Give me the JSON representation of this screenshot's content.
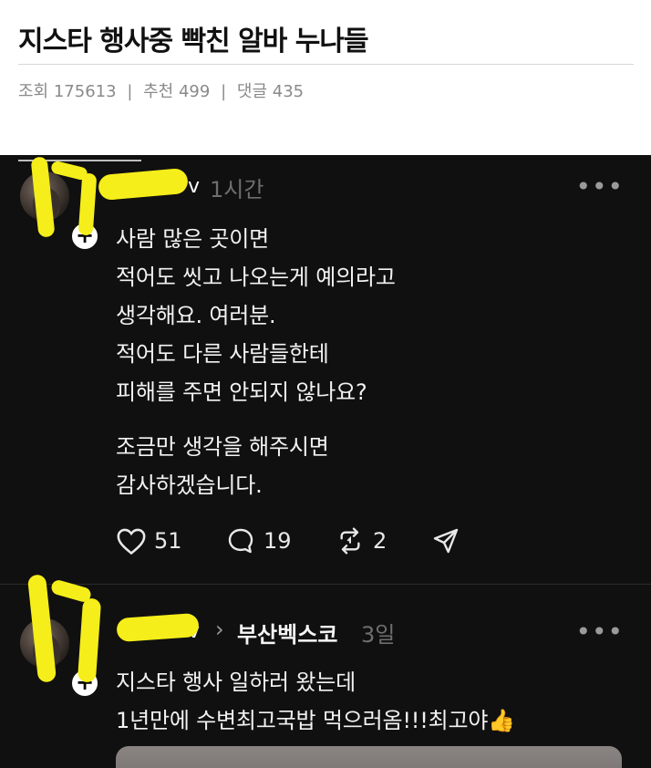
{
  "post": {
    "title": "지스타 행사중 빡친 알바 누나들",
    "meta": {
      "views_label": "조회",
      "views": "175613",
      "recommend_label": "추천",
      "recommend": "499",
      "comments_label": "댓글",
      "comments": "435",
      "separator": "|"
    }
  },
  "feed": {
    "items": [
      {
        "username_tail": "v",
        "time": "1시간",
        "lines": [
          "사람 많은 곳이면",
          "적어도 씻고 나오는게 예의라고",
          "생각해요. 여러분.",
          "적어도 다른 사람들한테",
          "피해를 주면 안되지 않나요?",
          "조금만 생각을 해주시면",
          "감사하겠습니다."
        ],
        "actions": {
          "likes": "51",
          "replies": "19",
          "reposts": "2"
        }
      },
      {
        "username_tail": "v",
        "community": "부산벡스코",
        "time": "3일",
        "lines": [
          "지스타 행사 일하러 왔는데",
          "1년만에 수변최고국밥 먹으러옴!!!최고야👍"
        ]
      }
    ],
    "icons": {
      "more": "more-horizontal-icon",
      "like": "heart-icon",
      "reply": "speech-bubble-icon",
      "repost": "repost-arrows-icon",
      "share": "send-icon",
      "follow": "plus-icon"
    },
    "more_glyph": "•••",
    "follow_glyph": "+",
    "chevron_glyph": "›"
  }
}
